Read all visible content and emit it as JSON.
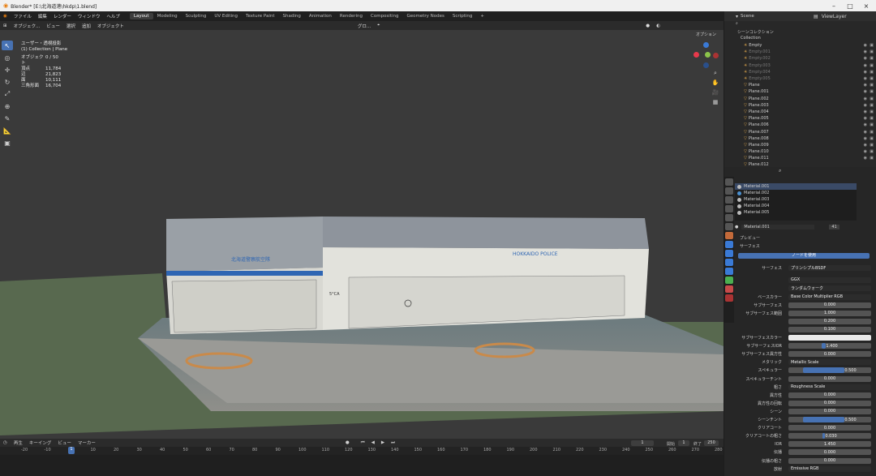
{
  "window": {
    "title": "Blender* [E:\\北海道港\\hkdp\\1.blend]"
  },
  "menu": {
    "items": [
      "ファイル",
      "編集",
      "レンダー",
      "ウィンドウ",
      "ヘルプ"
    ]
  },
  "workspaces": [
    "Layout",
    "Modeling",
    "Sculpting",
    "UV Editing",
    "Texture Paint",
    "Shading",
    "Animation",
    "Rendering",
    "Compositing",
    "Geometry Nodes",
    "Scripting",
    "+"
  ],
  "viewport_header": {
    "mode": "オブジェク...",
    "items": [
      "ビュー",
      "選択",
      "追加",
      "オブジェクト"
    ],
    "transform": "グロ...",
    "options": "オプション"
  },
  "stats": {
    "view": "ユーザー・透視投影",
    "collection": "(1) Collection | Plane",
    "rows": [
      {
        "k": "オブジェクト",
        "v": "0 / 50"
      },
      {
        "k": "頂点",
        "v": "11,784"
      },
      {
        "k": "辺",
        "v": "21,823"
      },
      {
        "k": "面",
        "v": "10,111"
      },
      {
        "k": "三角形面",
        "v": "16,704"
      }
    ]
  },
  "building": {
    "sign_jp": "北海道警察航空隊",
    "sign_en": "HOKKAIDO POLICE",
    "number": "5°CA"
  },
  "outliner": {
    "scene": "Scene",
    "viewlayer": "ViewLayer",
    "root": "シーンコレクション",
    "collection": "Collection",
    "items": [
      "Empty",
      "Empty.001",
      "Empty.002",
      "Empty.003",
      "Empty.004",
      "Empty.005",
      "Plane",
      "Plane.001",
      "Plane.002",
      "Plane.003",
      "Plane.004",
      "Plane.005",
      "Plane.006",
      "Plane.007",
      "Plane.008",
      "Plane.009",
      "Plane.010",
      "Plane.011",
      "Plane.012"
    ]
  },
  "materials": {
    "list": [
      "Material.001",
      "Material.002",
      "Material.003",
      "Material.004",
      "Material.005"
    ],
    "active": "Material.001",
    "users": "41"
  },
  "props": {
    "preview": "プレビュー",
    "surface_panel": "サーフェス",
    "use_nodes": "ノードを使用",
    "surface_label": "サーフェス",
    "surface_value": "プリンシプルBSDF",
    "dist": "GGX",
    "ss_method": "ランダムウォーク",
    "rows": [
      {
        "label": "ベースカラー",
        "value": "Base Color Multiplier RGB",
        "kind": "link"
      },
      {
        "label": "サブサーフェス",
        "value": "0.000",
        "fill": 0
      },
      {
        "label": "サブサーフェス範囲",
        "value": "1.000",
        "fill": 0
      },
      {
        "label": "",
        "value": "0.200",
        "fill": 0
      },
      {
        "label": "",
        "value": "0.100",
        "fill": 0
      },
      {
        "label": "サブサーフェスカラー",
        "value": "",
        "kind": "color"
      },
      {
        "label": "サブサーフェスIOR",
        "value": "1.400",
        "fill": 0.05
      },
      {
        "label": "サブサーフェス異方性",
        "value": "0.000",
        "fill": 0
      },
      {
        "label": "メタリック",
        "value": "Metallic Scale",
        "kind": "link"
      },
      {
        "label": "スペキュラー",
        "value": "0.500",
        "fill": 0.5
      },
      {
        "label": "スペキュラーチント",
        "value": "0.000",
        "fill": 0
      },
      {
        "label": "粗さ",
        "value": "Roughness Scale",
        "kind": "link"
      },
      {
        "label": "異方性",
        "value": "0.000",
        "fill": 0
      },
      {
        "label": "異方性の回転",
        "value": "0.000",
        "fill": 0
      },
      {
        "label": "シーン",
        "value": "0.000",
        "fill": 0
      },
      {
        "label": "シーンチント",
        "value": "0.500",
        "fill": 0.5
      },
      {
        "label": "クリアコート",
        "value": "0.000",
        "fill": 0
      },
      {
        "label": "クリアコートの粗さ",
        "value": "0.030",
        "fill": 0.03
      },
      {
        "label": "IOR",
        "value": "1.450",
        "fill": 0
      },
      {
        "label": "伝播",
        "value": "0.000",
        "fill": 0
      },
      {
        "label": "伝播の粗さ",
        "value": "0.000",
        "fill": 0
      },
      {
        "label": "放射",
        "value": "Emissive RGB",
        "kind": "link"
      }
    ]
  },
  "timeline": {
    "menu": [
      "再生",
      "キーイング",
      "ビュー",
      "マーカー"
    ],
    "ticks": [
      "-20",
      "-10",
      "",
      "10",
      "20",
      "30",
      "40",
      "50",
      "60",
      "70",
      "80",
      "90",
      "100",
      "110",
      "120",
      "130",
      "140",
      "150",
      "160",
      "170",
      "180",
      "190",
      "200",
      "210",
      "220",
      "230",
      "240",
      "250",
      "260",
      "270",
      "280"
    ],
    "current": "1",
    "start_label": "開始",
    "start": "1",
    "end_label": "終了",
    "end": "250"
  },
  "colors": {
    "accent": "#4772b3",
    "gizmo_x": "#e8394b",
    "gizmo_y": "#8bc34a",
    "gizmo_z": "#3a7ad6"
  }
}
